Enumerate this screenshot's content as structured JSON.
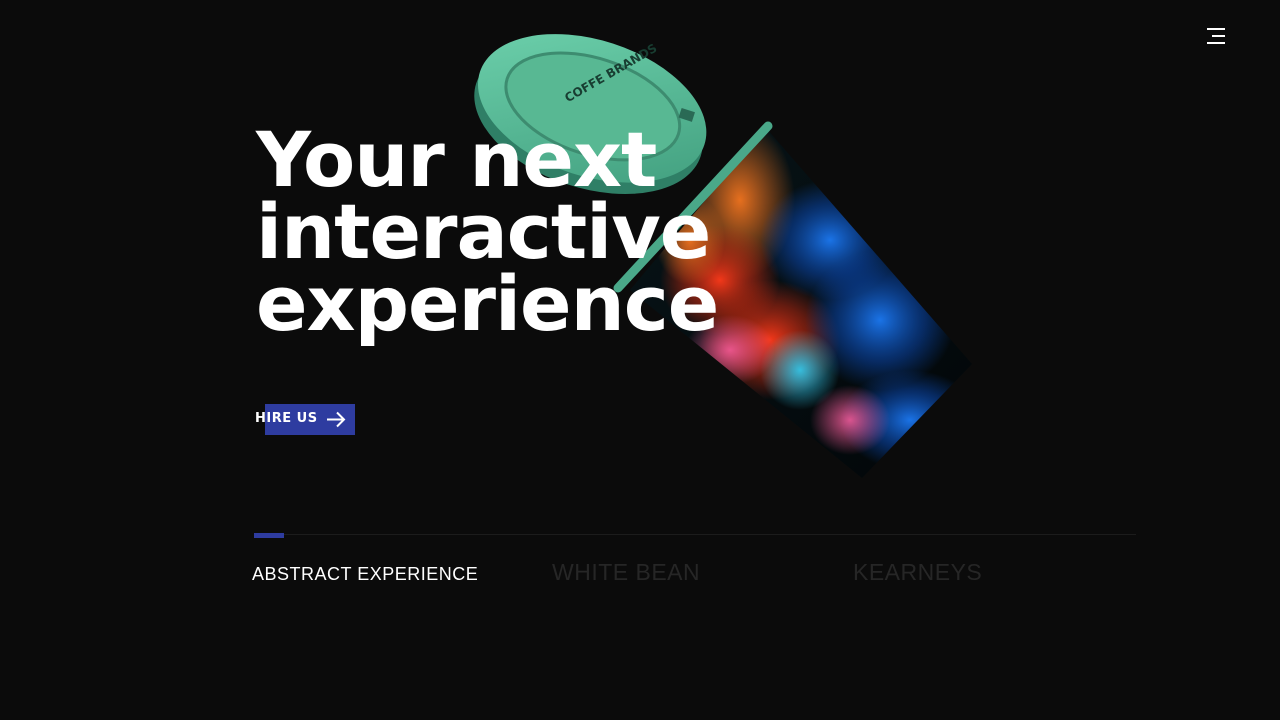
{
  "hero": {
    "headline_line1": "Your next",
    "headline_line2": "interactive",
    "headline_line3": "experience",
    "cup_lid_text": "COFFE BRANDS",
    "cta_label": "HIRE US"
  },
  "slider": {
    "tabs": [
      {
        "label": "ABSTRACT EXPERIENCE",
        "active": true
      },
      {
        "label": "WHITE BEAN",
        "active": false
      },
      {
        "label": "KEARNEYS",
        "active": false
      }
    ]
  },
  "colors": {
    "background": "#0b0b0b",
    "accent": "#2e3ca0",
    "text": "#ffffff",
    "inactive_text": "#262626",
    "lid": "#5fbf9c"
  },
  "icons": {
    "menu": "hamburger-menu-icon",
    "cta": "arrow-right-icon"
  }
}
